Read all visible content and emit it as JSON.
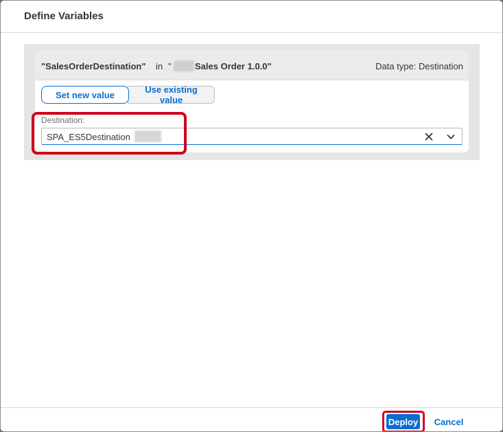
{
  "dialog": {
    "title": "Define Variables"
  },
  "variable": {
    "name_quoted": "\"SalesOrderDestination\"",
    "in_word": "in",
    "open_quote": "\"",
    "artifact_name": "Sales Order 1.0.0\"",
    "data_type": "Data type: Destination"
  },
  "mode": {
    "set_new_label": "Set new value",
    "use_existing_label": "Use existing value",
    "selected": "Set new value"
  },
  "destination": {
    "label": "Destination:",
    "value": "SPA_ES5Destination"
  },
  "icons": {
    "clear": "close-icon",
    "dropdown": "chevron-down-icon"
  },
  "footer": {
    "deploy_label": "Deploy",
    "cancel_label": "Cancel"
  },
  "colors": {
    "accent": "#0a6ed1",
    "highlight": "#d0021b"
  }
}
